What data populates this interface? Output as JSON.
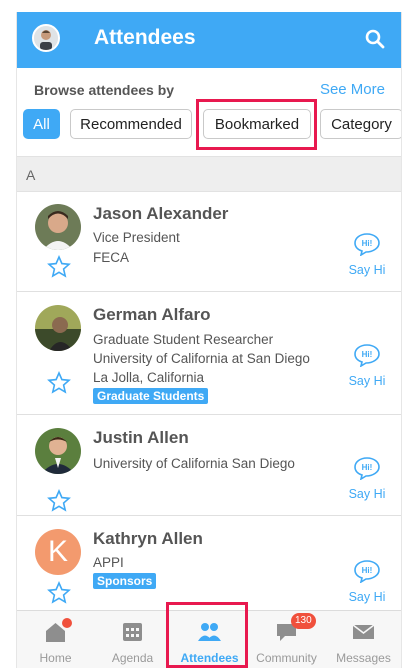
{
  "header": {
    "title": "Attendees",
    "search_icon": "search-icon",
    "profile_icon": "avatar"
  },
  "browse": {
    "label": "Browse attendees by",
    "see_more": "See More",
    "chips": [
      "All",
      "Recommended",
      "Bookmarked",
      "Category"
    ],
    "active_chip": "All"
  },
  "section_letter": "A",
  "attendees": [
    {
      "name": "Jason Alexander",
      "lines": [
        "Vice President",
        "FECA"
      ],
      "tag": "",
      "say_hi": "Say Hi",
      "avatar_letter": ""
    },
    {
      "name": "German Alfaro",
      "lines": [
        "Graduate Student Researcher",
        "University of California at San Diego",
        "La Jolla, California"
      ],
      "tag": "Graduate Students",
      "say_hi": "Say Hi",
      "avatar_letter": ""
    },
    {
      "name": "Justin Allen",
      "lines": [
        "University of California San Diego"
      ],
      "tag": "",
      "say_hi": "Say Hi",
      "avatar_letter": ""
    },
    {
      "name": "Kathryn Allen",
      "lines": [
        "APPI"
      ],
      "tag": "Sponsors",
      "say_hi": "Say Hi",
      "avatar_letter": "K"
    }
  ],
  "say_hi_bubble": "Hi!",
  "bottom_nav": {
    "items": [
      {
        "label": "Home",
        "icon": "home-icon"
      },
      {
        "label": "Agenda",
        "icon": "calendar-icon"
      },
      {
        "label": "Attendees",
        "icon": "people-icon"
      },
      {
        "label": "Community",
        "icon": "chat-icon",
        "badge": "130"
      },
      {
        "label": "Messages",
        "icon": "envelope-icon"
      }
    ],
    "active": "Attendees"
  },
  "colors": {
    "accent": "#3fa9f5",
    "highlight": "#e8194f",
    "badge": "#f0503c"
  }
}
